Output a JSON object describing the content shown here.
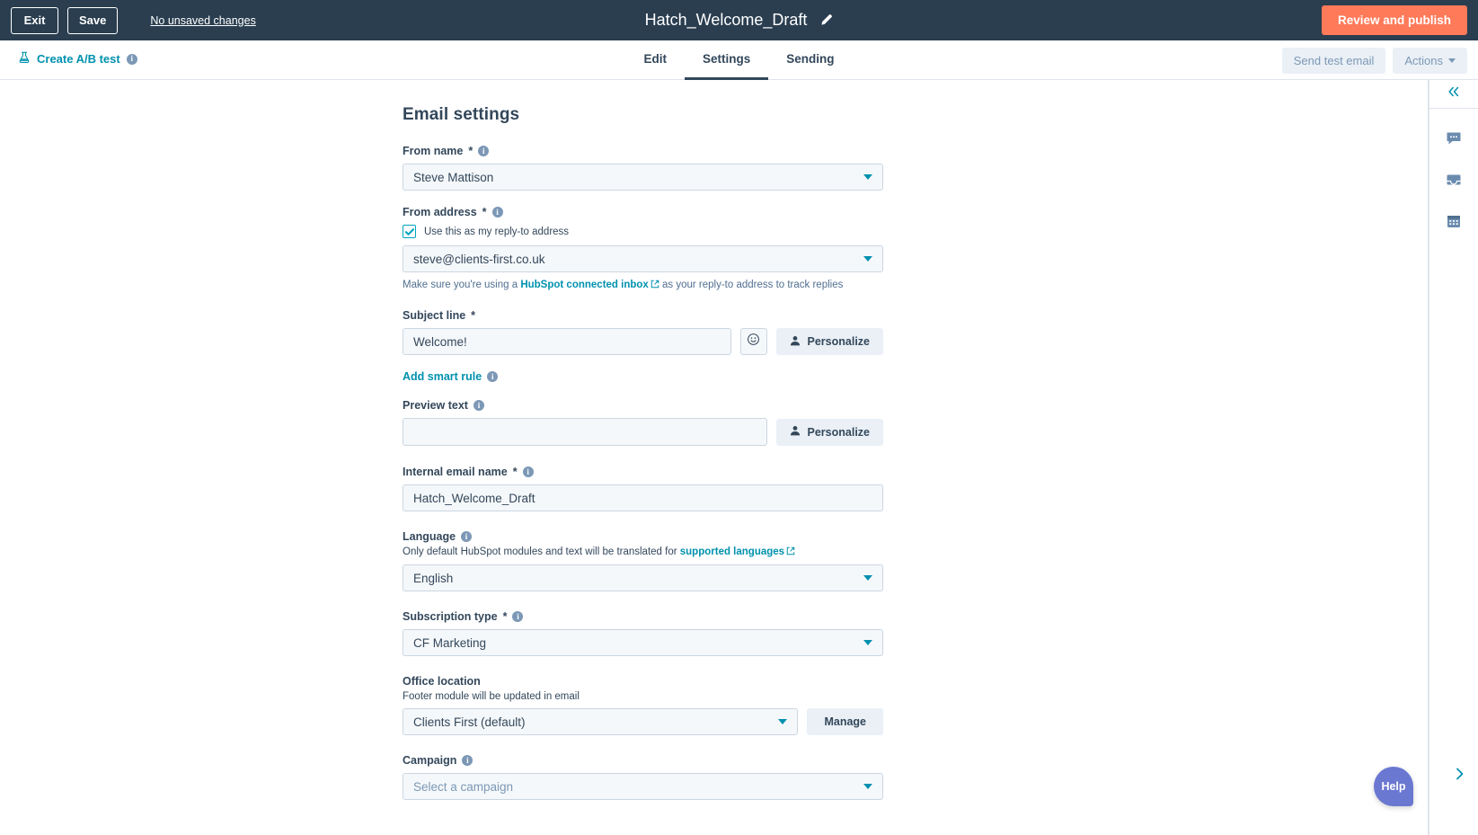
{
  "topbar": {
    "exit_label": "Exit",
    "save_label": "Save",
    "unsaved_label": "No unsaved changes",
    "title": "Hatch_Welcome_Draft",
    "review_label": "Review and publish",
    "accent_color": "#ff7a59",
    "background_color": "#2a3e50"
  },
  "subbar": {
    "ab_test_label": "Create A/B test",
    "tabs": [
      {
        "label": "Edit",
        "active": false
      },
      {
        "label": "Settings",
        "active": true
      },
      {
        "label": "Sending",
        "active": false
      }
    ],
    "send_test_email_label": "Send test email",
    "actions_label": "Actions"
  },
  "main": {
    "page_title": "Email settings",
    "from_name": {
      "label": "From name",
      "required": "*",
      "value": "Steve Mattison"
    },
    "from_address": {
      "label": "From address",
      "required": "*",
      "checkbox_label": "Use this as my reply-to address",
      "checked": true,
      "value": "steve@clients-first.co.uk",
      "note_prefix": "Make sure you're using a ",
      "note_link": "HubSpot connected inbox",
      "note_suffix": " as your reply-to address to track replies"
    },
    "subject_line": {
      "label": "Subject line",
      "required": "*",
      "value": "Welcome!",
      "personalize_label": "Personalize"
    },
    "smart_rule": {
      "label": "Add smart rule"
    },
    "preview_text": {
      "label": "Preview text",
      "value": "",
      "personalize_label": "Personalize"
    },
    "internal_email_name": {
      "label": "Internal email name",
      "required": "*",
      "value": "Hatch_Welcome_Draft"
    },
    "language": {
      "label": "Language",
      "sublabel_prefix": "Only default HubSpot modules and text will be translated for ",
      "sublabel_link": "supported languages",
      "value": "English"
    },
    "subscription_type": {
      "label": "Subscription type",
      "required": "*",
      "value": "CF Marketing"
    },
    "office_location": {
      "label": "Office location",
      "sublabel": "Footer module will be updated in email",
      "value": "Clients First (default)",
      "manage_label": "Manage"
    },
    "campaign": {
      "label": "Campaign",
      "placeholder": "Select a campaign"
    }
  },
  "right_rail": {
    "collapse_icon": "chevron-double-left-icon",
    "items": [
      {
        "icon": "chat-bubble-icon"
      },
      {
        "icon": "inbox-icon"
      },
      {
        "icon": "calendar-icon"
      }
    ],
    "expand_icon": "chevron-right-icon"
  },
  "help": {
    "label": "Help",
    "color": "#6a78d1"
  }
}
